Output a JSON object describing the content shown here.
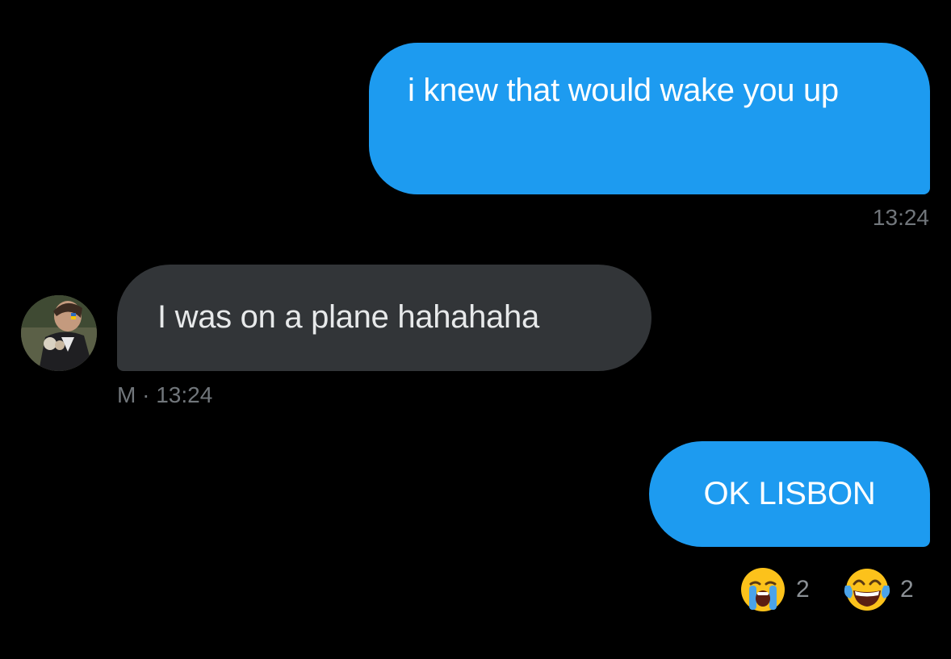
{
  "conversation": {
    "messages": [
      {
        "direction": "outgoing",
        "text": "i knew that would wake you up",
        "time": "13:24"
      },
      {
        "direction": "incoming",
        "text": "I was on a plane hahahaha",
        "sender": "M",
        "time": "13:24",
        "meta": "M · 13:24"
      },
      {
        "direction": "outgoing",
        "text": "OK LISBON",
        "reactions": [
          {
            "icon": "loudly-crying-face-icon",
            "count": "2"
          },
          {
            "icon": "face-with-tears-of-joy-icon",
            "count": "2"
          }
        ]
      }
    ]
  },
  "colors": {
    "background": "#000000",
    "outgoing_bubble": "#1d9bf0",
    "incoming_bubble": "#323538",
    "meta_text": "#71767b"
  }
}
